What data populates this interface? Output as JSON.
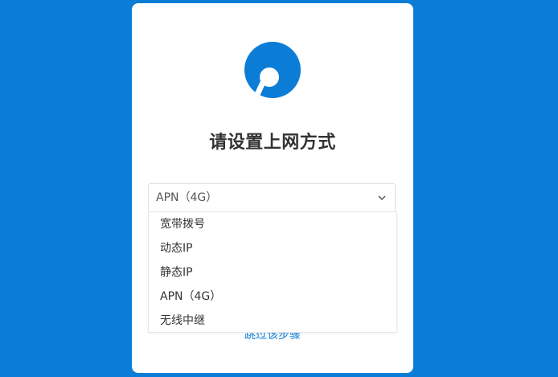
{
  "brand": {
    "accent_color": "#0b7dd7",
    "logo_icon": "router-logo-icon"
  },
  "setup": {
    "title": "请设置上网方式"
  },
  "connection_select": {
    "selected": "APN（4G）",
    "options": [
      "宽带拨号",
      "动态IP",
      "静态IP",
      "APN（4G）",
      "无线中继"
    ]
  },
  "skip": {
    "label": "跳过该步骤"
  }
}
